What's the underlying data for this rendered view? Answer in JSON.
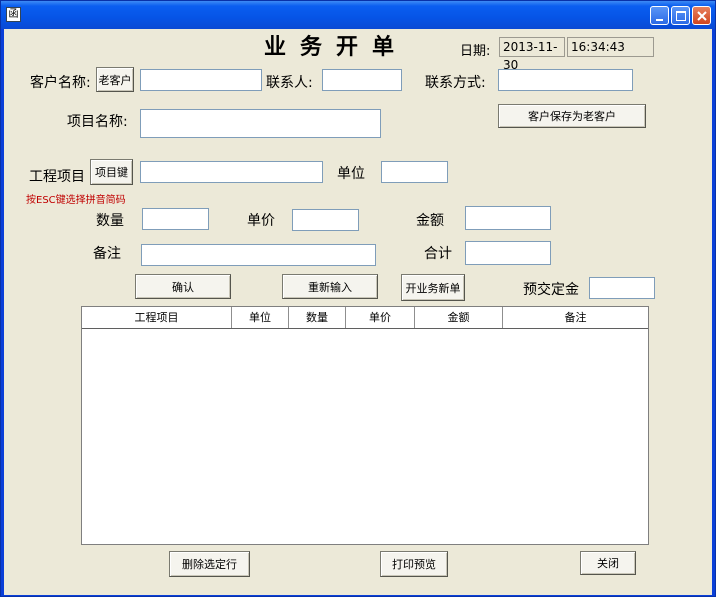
{
  "window": {
    "icon_glyph": "函"
  },
  "form": {
    "title": "业务开单",
    "date_label": "日期:",
    "date_value": "2013-11-30",
    "time_value": "16:34:43",
    "customer_name_label": "客户名称:",
    "old_customer_button": "老客户",
    "contact_label": "联系人:",
    "contact_method_label": "联系方式:",
    "project_name_label": "项目名称:",
    "save_customer_button": "客户保存为老客户",
    "work_item_label": "工程项目",
    "item_key_button": "项目键",
    "unit_label": "单位",
    "esc_hint": "按ESC键选择拼音简码",
    "quantity_label": "数量",
    "unit_price_label": "单价",
    "amount_label": "金额",
    "remark_label": "备注",
    "total_label": "合计",
    "confirm_button": "确认",
    "reenter_button": "重新输入",
    "new_order_button": "开业务新单",
    "deposit_label": "预交定金"
  },
  "table": {
    "columns": [
      "工程项目",
      "单位",
      "数量",
      "单价",
      "金额",
      "备注"
    ]
  },
  "footer": {
    "delete_button": "删除选定行",
    "print_preview_button": "打印预览",
    "close_button": "关闭"
  },
  "colors": {
    "title_bar": "#0654e6",
    "client_bg": "#ece9d8",
    "hint_text": "#c00000",
    "close_button": "#d0451e"
  },
  "icons": {
    "app": "app-icon",
    "minimize": "minimize-icon",
    "maximize": "maximize-icon",
    "close": "close-icon"
  }
}
